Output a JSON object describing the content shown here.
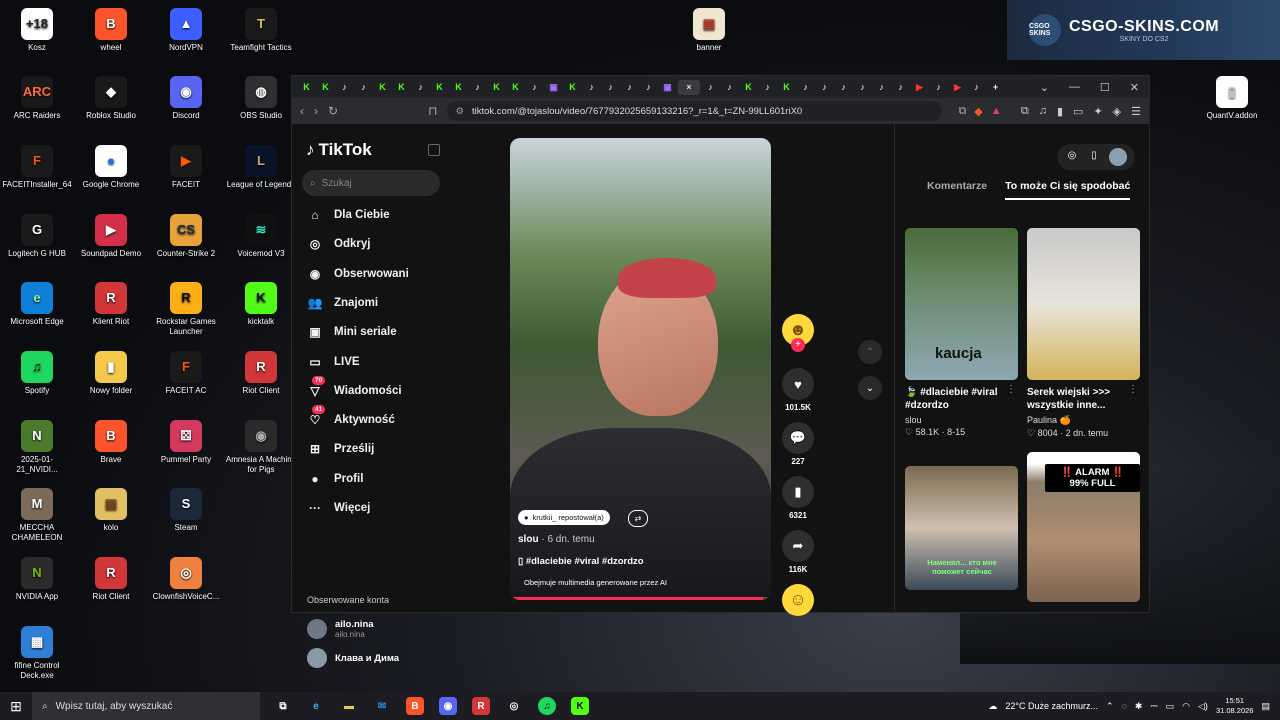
{
  "desktop": {
    "icons": [
      {
        "label": "Kosz",
        "glyph": "+18",
        "bg": "#ffffff",
        "fg": "#222"
      },
      {
        "label": "ARC Raiders",
        "glyph": "ARC",
        "bg": "#1a1a1a",
        "fg": "#ff6b3d"
      },
      {
        "label": "FACEITInstaller_64",
        "glyph": "F",
        "bg": "#1a1a1a",
        "fg": "#ff5500"
      },
      {
        "label": "Logitech G HUB",
        "glyph": "G",
        "bg": "#1a1a1a",
        "fg": "#ffffff"
      },
      {
        "label": "Microsoft Edge",
        "glyph": "e",
        "bg": "#0f7fd8",
        "fg": "#8ee9a5"
      },
      {
        "label": "Spotify",
        "glyph": "♫",
        "bg": "#1ed760",
        "fg": "#111"
      },
      {
        "label": "2025-01-21_NVIDI...",
        "glyph": "N",
        "bg": "#4c7a2c",
        "fg": "#fff"
      },
      {
        "label": "MECCHA CHAMELEON",
        "glyph": "M",
        "bg": "#7a6a5a",
        "fg": "#fff"
      },
      {
        "label": "NVIDIA App",
        "glyph": "N",
        "bg": "#2b2b2b",
        "fg": "#76b900"
      },
      {
        "label": "fifine Control Deck.exe",
        "glyph": "▦",
        "bg": "#2f7fd6",
        "fg": "#fff"
      },
      {
        "label": "wheel",
        "glyph": "B",
        "bg": "#fb542b",
        "fg": "#fff"
      },
      {
        "label": "Roblox Studio",
        "glyph": "◆",
        "bg": "#1a1a1a",
        "fg": "#fff"
      },
      {
        "label": "Google Chrome",
        "glyph": "●",
        "bg": "#ffffff",
        "fg": "#1a73e8"
      },
      {
        "label": "Soundpad Demo",
        "glyph": "▶",
        "bg": "#d32f4a",
        "fg": "#fff"
      },
      {
        "label": "Klient Riot",
        "glyph": "R",
        "bg": "#d13639",
        "fg": "#fff"
      },
      {
        "label": "Nowy folder",
        "glyph": "▮",
        "bg": "#f3c84b",
        "fg": "#fff"
      },
      {
        "label": "Brave",
        "glyph": "B",
        "bg": "#fb542b",
        "fg": "#fff"
      },
      {
        "label": "kolo",
        "glyph": "▤",
        "bg": "#e0c060",
        "fg": "#7a4a20"
      },
      {
        "label": "Riot Client",
        "glyph": "R",
        "bg": "#d13639",
        "fg": "#fff"
      },
      {
        "label": "NordVPN",
        "glyph": "▲",
        "bg": "#3e5fff",
        "fg": "#fff"
      },
      {
        "label": "Discord",
        "glyph": "◉",
        "bg": "#5865f2",
        "fg": "#fff"
      },
      {
        "label": "FACEIT",
        "glyph": "▶",
        "bg": "#1a1a1a",
        "fg": "#ff5500"
      },
      {
        "label": "Counter-Strike 2",
        "glyph": "CS",
        "bg": "#e8a23a",
        "fg": "#1a2a40"
      },
      {
        "label": "Rockstar Games Launcher",
        "glyph": "R",
        "bg": "#fcaf17",
        "fg": "#111"
      },
      {
        "label": "FACEIT AC",
        "glyph": "F",
        "bg": "#1a1a1a",
        "fg": "#ff5500"
      },
      {
        "label": "Pummel Party",
        "glyph": "⚄",
        "bg": "#d33a5e",
        "fg": "#fff"
      },
      {
        "label": "Steam",
        "glyph": "S",
        "bg": "#1b2838",
        "fg": "#fff"
      },
      {
        "label": "ClownfishVoiceC...",
        "glyph": "◎",
        "bg": "#f08040",
        "fg": "#fff"
      },
      {
        "label": "Teamfight Tactics",
        "glyph": "T",
        "bg": "#1a1a1a",
        "fg": "#e8c040"
      },
      {
        "label": "OBS Studio",
        "glyph": "◍",
        "bg": "#302e31",
        "fg": "#fff"
      },
      {
        "label": "League of Legends",
        "glyph": "L",
        "bg": "#0a1428",
        "fg": "#c8aa6e"
      },
      {
        "label": "Voicemod V3",
        "glyph": "≋",
        "bg": "#111",
        "fg": "#3ce6c8"
      },
      {
        "label": "kicktalk",
        "glyph": "K",
        "bg": "#53fc18",
        "fg": "#111"
      },
      {
        "label": "Riot Client",
        "glyph": "R",
        "bg": "#d13639",
        "fg": "#fff"
      },
      {
        "label": "Amnesia A Machine for Pigs",
        "glyph": "◉",
        "bg": "#2a2a2a",
        "fg": "#aaa"
      }
    ],
    "banner_icon": {
      "label": "banner",
      "glyph": "▤",
      "bg": "#f0e6d0",
      "fg": "#c0392b"
    },
    "quant_icon": {
      "label": "QuantV.addon",
      "glyph": "▯",
      "bg": "#ffffff",
      "fg": "#ccc"
    },
    "ad": {
      "title": "CSGO-SKINS.COM",
      "subtitle": "SKINY DO CS2",
      "logo_text": "CSGO SKINS"
    }
  },
  "browser": {
    "url": "tiktok.com/@tojaslou/video/7677932025659133216?_r=1&_t=ZN-99LL601riX0",
    "tabs": [
      "K",
      "K",
      "♪",
      "♪",
      "K",
      "K",
      "♪",
      "K",
      "K",
      "♪",
      "K",
      "K",
      "♪",
      "▣",
      "K",
      "♪",
      "♪",
      "♪",
      "♪",
      "▣",
      "×",
      "♪",
      "♪",
      "K",
      "♪",
      "K",
      "♪",
      "♪",
      "♪",
      "♪",
      "♪",
      "♪",
      "▶",
      "♪",
      "▶",
      "♪",
      "+"
    ],
    "tab_types": [
      "k",
      "k",
      "t",
      "t",
      "k",
      "k",
      "t",
      "k",
      "k",
      "t",
      "k",
      "k",
      "t",
      "tw",
      "k",
      "t",
      "t",
      "t",
      "t",
      "tw",
      "active",
      "t",
      "t",
      "k",
      "t",
      "k",
      "t",
      "t",
      "t",
      "t",
      "t",
      "t",
      "yt",
      "t",
      "yt",
      "t",
      "t"
    ],
    "window_controls": [
      "⌄",
      "—",
      "☐",
      "✕"
    ]
  },
  "tiktok": {
    "logo": "TikTok",
    "search_placeholder": "Szukaj",
    "nav": [
      {
        "label": "Dla Ciebie",
        "icon": "⌂",
        "badge": ""
      },
      {
        "label": "Odkryj",
        "icon": "◎",
        "badge": ""
      },
      {
        "label": "Obserwowani",
        "icon": "◉",
        "badge": ""
      },
      {
        "label": "Znajomi",
        "icon": "👥",
        "badge": ""
      },
      {
        "label": "Mini seriale",
        "icon": "▣",
        "badge": ""
      },
      {
        "label": "LIVE",
        "icon": "▭",
        "badge": ""
      },
      {
        "label": "Wiadomości",
        "icon": "▽",
        "badge": "70"
      },
      {
        "label": "Aktywność",
        "icon": "♡",
        "badge": "41"
      },
      {
        "label": "Prześlij",
        "icon": "⊞",
        "badge": ""
      },
      {
        "label": "Profil",
        "icon": "●",
        "badge": ""
      },
      {
        "label": "Więcej",
        "icon": "···",
        "badge": ""
      }
    ],
    "followed_header": "Obserwowane konta",
    "followed": [
      {
        "name": "ailo.nina",
        "handle": "ailo.nina"
      },
      {
        "name": "Клава и Дима",
        "handle": ""
      }
    ],
    "video": {
      "repost": "krutkii_ repostował(a)",
      "author": "slou",
      "age": "· 6 dn. temu",
      "tags": "▯ #dlaciebie #viral #dzordzo",
      "ai_notice": "Obejmuje multimedia generowane przez AI",
      "progress": 0.97
    },
    "actions": {
      "likes": "101.5K",
      "comments": "227",
      "saves": "6321",
      "shares": "116K"
    },
    "right_tabs": [
      "Komentarze",
      "To może Ci się spodobać"
    ],
    "recommended": [
      {
        "title": "🍃 #dlaciebie #viral #dzordzo",
        "author": "slou",
        "stats": "♡ 58.1K · 8-15",
        "overlay": "kaucja"
      },
      {
        "title": "Serek wiejski >>> wszystkie inne...",
        "author": "Paulina 🍊",
        "stats": "♡ 8004 · 2 dn. temu",
        "overlay": ""
      },
      {
        "title": "",
        "author": "",
        "stats": "",
        "overlay": "Наменял... кто мне поможет сейчас"
      },
      {
        "title": "",
        "author": "",
        "stats": "",
        "overlay": "‼️ ALARM ‼️ 99% FULL"
      }
    ]
  },
  "taskbar": {
    "search_placeholder": "Wpisz tutaj, aby wyszukać",
    "weather": "22°C  Duże zachmurz...",
    "time": "15:51",
    "date": "31.08.2026"
  }
}
